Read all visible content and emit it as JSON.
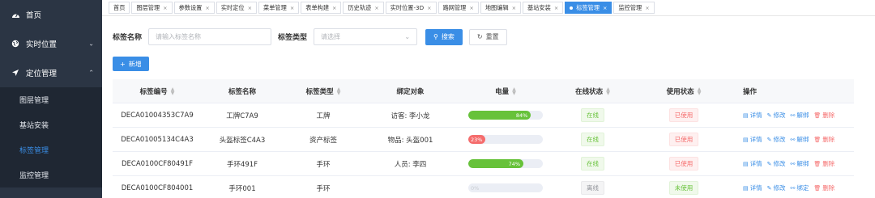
{
  "sidebar": {
    "items": [
      {
        "label": "首页",
        "icon": "dashboard-icon"
      },
      {
        "label": "实时位置",
        "icon": "globe-icon"
      },
      {
        "label": "定位管理",
        "icon": "location-arrow-icon"
      }
    ],
    "sub_items": [
      {
        "label": "图层管理"
      },
      {
        "label": "基站安装"
      },
      {
        "label": "标签管理"
      },
      {
        "label": "监控管理"
      }
    ]
  },
  "tabs": [
    {
      "label": "首页"
    },
    {
      "label": "图层管理"
    },
    {
      "label": "参数设置"
    },
    {
      "label": "实时定位"
    },
    {
      "label": "菜单管理"
    },
    {
      "label": "表单构建"
    },
    {
      "label": "历史轨迹"
    },
    {
      "label": "实时位置-3D"
    },
    {
      "label": "路网管理"
    },
    {
      "label": "地图编辑"
    },
    {
      "label": "基站安装"
    },
    {
      "label": "标签管理"
    },
    {
      "label": "监控管理"
    }
  ],
  "search": {
    "name_label": "标签名称",
    "name_placeholder": "请输入标签名称",
    "type_label": "标签类型",
    "type_placeholder": "请选择",
    "search_button": "搜索",
    "reset_button": "重置"
  },
  "add_button": "新增",
  "table": {
    "headers": [
      "标签编号",
      "标签名称",
      "标签类型",
      "绑定对象",
      "电量",
      "在线状态",
      "使用状态",
      "操作"
    ],
    "rows": [
      {
        "id": "DECA01004353C7A9",
        "name": "工牌C7A9",
        "type": "工牌",
        "bind": "访客: 李小龙",
        "battery": 84,
        "battery_label": "84%",
        "online": "在线",
        "usage": "已使用",
        "ops": [
          "详情",
          "修改",
          "解绑",
          "删除"
        ]
      },
      {
        "id": "DECA01005134C4A3",
        "name": "头盔标签C4A3",
        "type": "资产标签",
        "bind": "物品: 头盔001",
        "battery": 23,
        "battery_label": "23%",
        "online": "在线",
        "usage": "已使用",
        "ops": [
          "详情",
          "修改",
          "解绑",
          "删除"
        ]
      },
      {
        "id": "DECA0100CF80491F",
        "name": "手环491F",
        "type": "手环",
        "bind": "人员: 李四",
        "battery": 74,
        "battery_label": "74%",
        "online": "在线",
        "usage": "已使用",
        "ops": [
          "详情",
          "修改",
          "解绑",
          "删除"
        ]
      },
      {
        "id": "DECA0100CF804001",
        "name": "手环001",
        "type": "手环",
        "bind": "",
        "battery": 0,
        "battery_label": "0%",
        "online": "离线",
        "usage": "未使用",
        "ops": [
          "详情",
          "修改",
          "绑定",
          "删除"
        ]
      }
    ]
  },
  "colors": {
    "primary": "#3a8ee6",
    "sidebar": "#2b3544",
    "success": "#67c23a",
    "danger": "#f56c6c"
  }
}
